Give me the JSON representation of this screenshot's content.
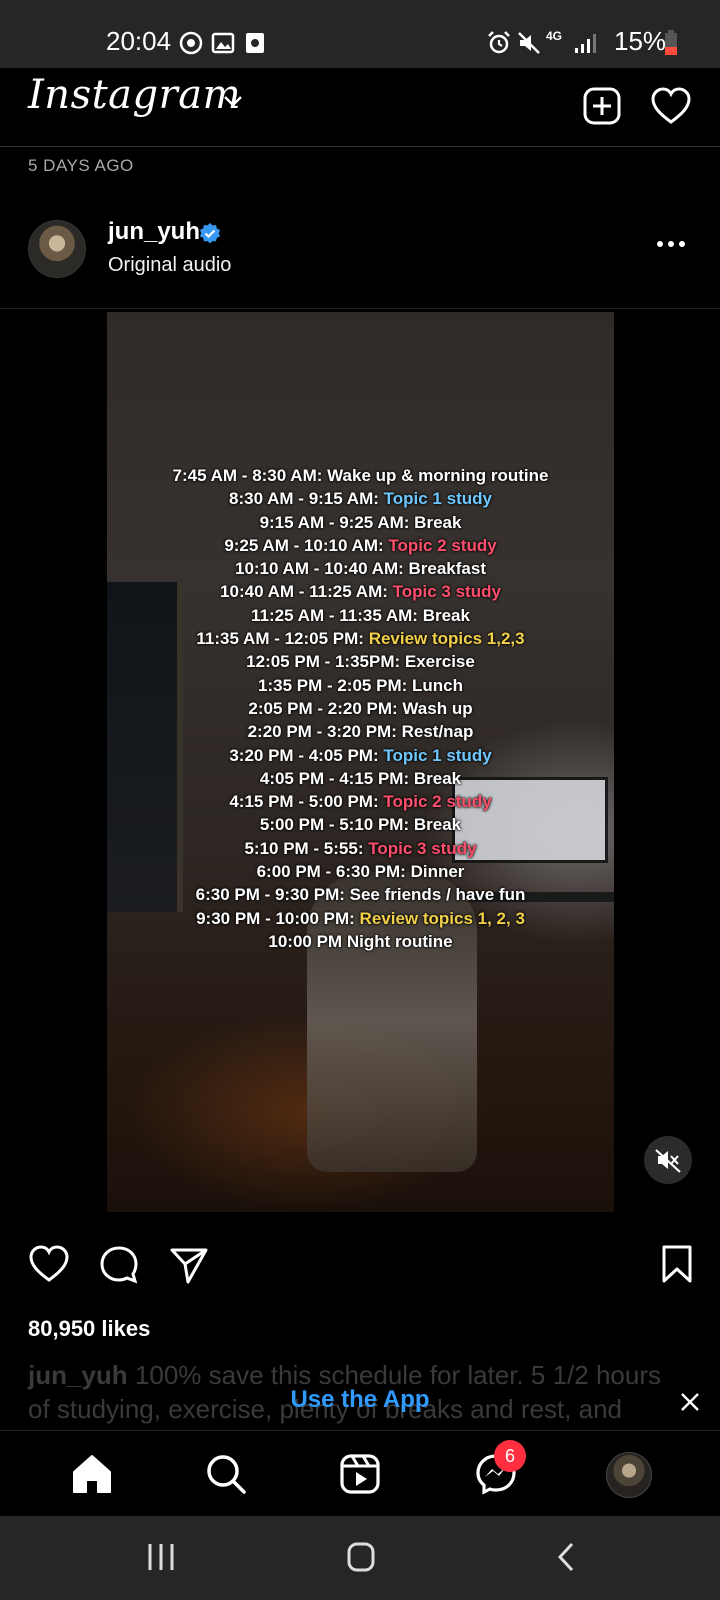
{
  "status_bar": {
    "time": "20:04",
    "battery": "15%",
    "network": "4G"
  },
  "header": {
    "logo": "Instagram"
  },
  "post": {
    "age": "5 DAYS AGO",
    "username": "jun_yuh",
    "audio": "Original audio",
    "likes": "80,950 likes",
    "caption_user": "jun_yuh",
    "caption_text": "100% save this schedule for later. 5 1/2 hours of studying, exercise, plenty of breaks and rest, and"
  },
  "schedule": [
    {
      "time": "7:45 AM - 8:30 AM: ",
      "activity": "Wake up & morning routine",
      "style": "plain"
    },
    {
      "time": "8:30 AM - 9:15 AM: ",
      "activity": "Topic 1 study",
      "style": "blue"
    },
    {
      "time": "9:15 AM - 9:25 AM: ",
      "activity": "Break",
      "style": "plain"
    },
    {
      "time": "9:25 AM - 10:10 AM: ",
      "activity": "Topic 2 study",
      "style": "red"
    },
    {
      "time": "10:10 AM - 10:40 AM: ",
      "activity": "Breakfast",
      "style": "plain"
    },
    {
      "time": "10:40 AM - 11:25 AM: ",
      "activity": "Topic 3 study",
      "style": "red"
    },
    {
      "time": "11:25 AM - 11:35 AM: ",
      "activity": "Break",
      "style": "plain"
    },
    {
      "time": "11:35 AM - 12:05 PM: ",
      "activity": "Review topics 1,2,3",
      "style": "yellow"
    },
    {
      "time": "12:05 PM - 1:35PM: ",
      "activity": "Exercise",
      "style": "plain"
    },
    {
      "time": "1:35 PM - 2:05 PM: ",
      "activity": "Lunch",
      "style": "plain"
    },
    {
      "time": "2:05 PM - 2:20 PM: ",
      "activity": "Wash up",
      "style": "plain"
    },
    {
      "time": "2:20 PM - 3:20 PM: ",
      "activity": "Rest/nap",
      "style": "plain"
    },
    {
      "time": "3:20 PM - 4:05 PM: ",
      "activity": "Topic 1 study",
      "style": "blue"
    },
    {
      "time": "4:05 PM - 4:15 PM: ",
      "activity": "Break",
      "style": "plain"
    },
    {
      "time": "4:15 PM - 5:00 PM: ",
      "activity": "Topic 2 study",
      "style": "red"
    },
    {
      "time": "5:00 PM - 5:10 PM: ",
      "activity": "Break",
      "style": "plain"
    },
    {
      "time": "5:10 PM - 5:55: ",
      "activity": "Topic 3 study",
      "style": "red"
    },
    {
      "time": "6:00 PM - 6:30 PM: ",
      "activity": "Dinner",
      "style": "plain"
    },
    {
      "time": "6:30 PM - 9:30 PM: ",
      "activity": "See friends / have fun",
      "style": "plain"
    },
    {
      "time": "9:30 PM - 10:00 PM: ",
      "activity": "Review topics 1, 2, 3",
      "style": "yellow"
    },
    {
      "time": "10:00 PM ",
      "activity": "Night routine",
      "style": "plain"
    }
  ],
  "banner": {
    "label": "Use the App"
  },
  "bottom_nav": {
    "messenger_badge": "6"
  },
  "colors": {
    "link_blue": "#2f9bff",
    "topic_blue": "#6ec8ff",
    "topic_red": "#ff4f6d",
    "review_yellow": "#f2d04a",
    "badge_red": "#ff2f40"
  }
}
